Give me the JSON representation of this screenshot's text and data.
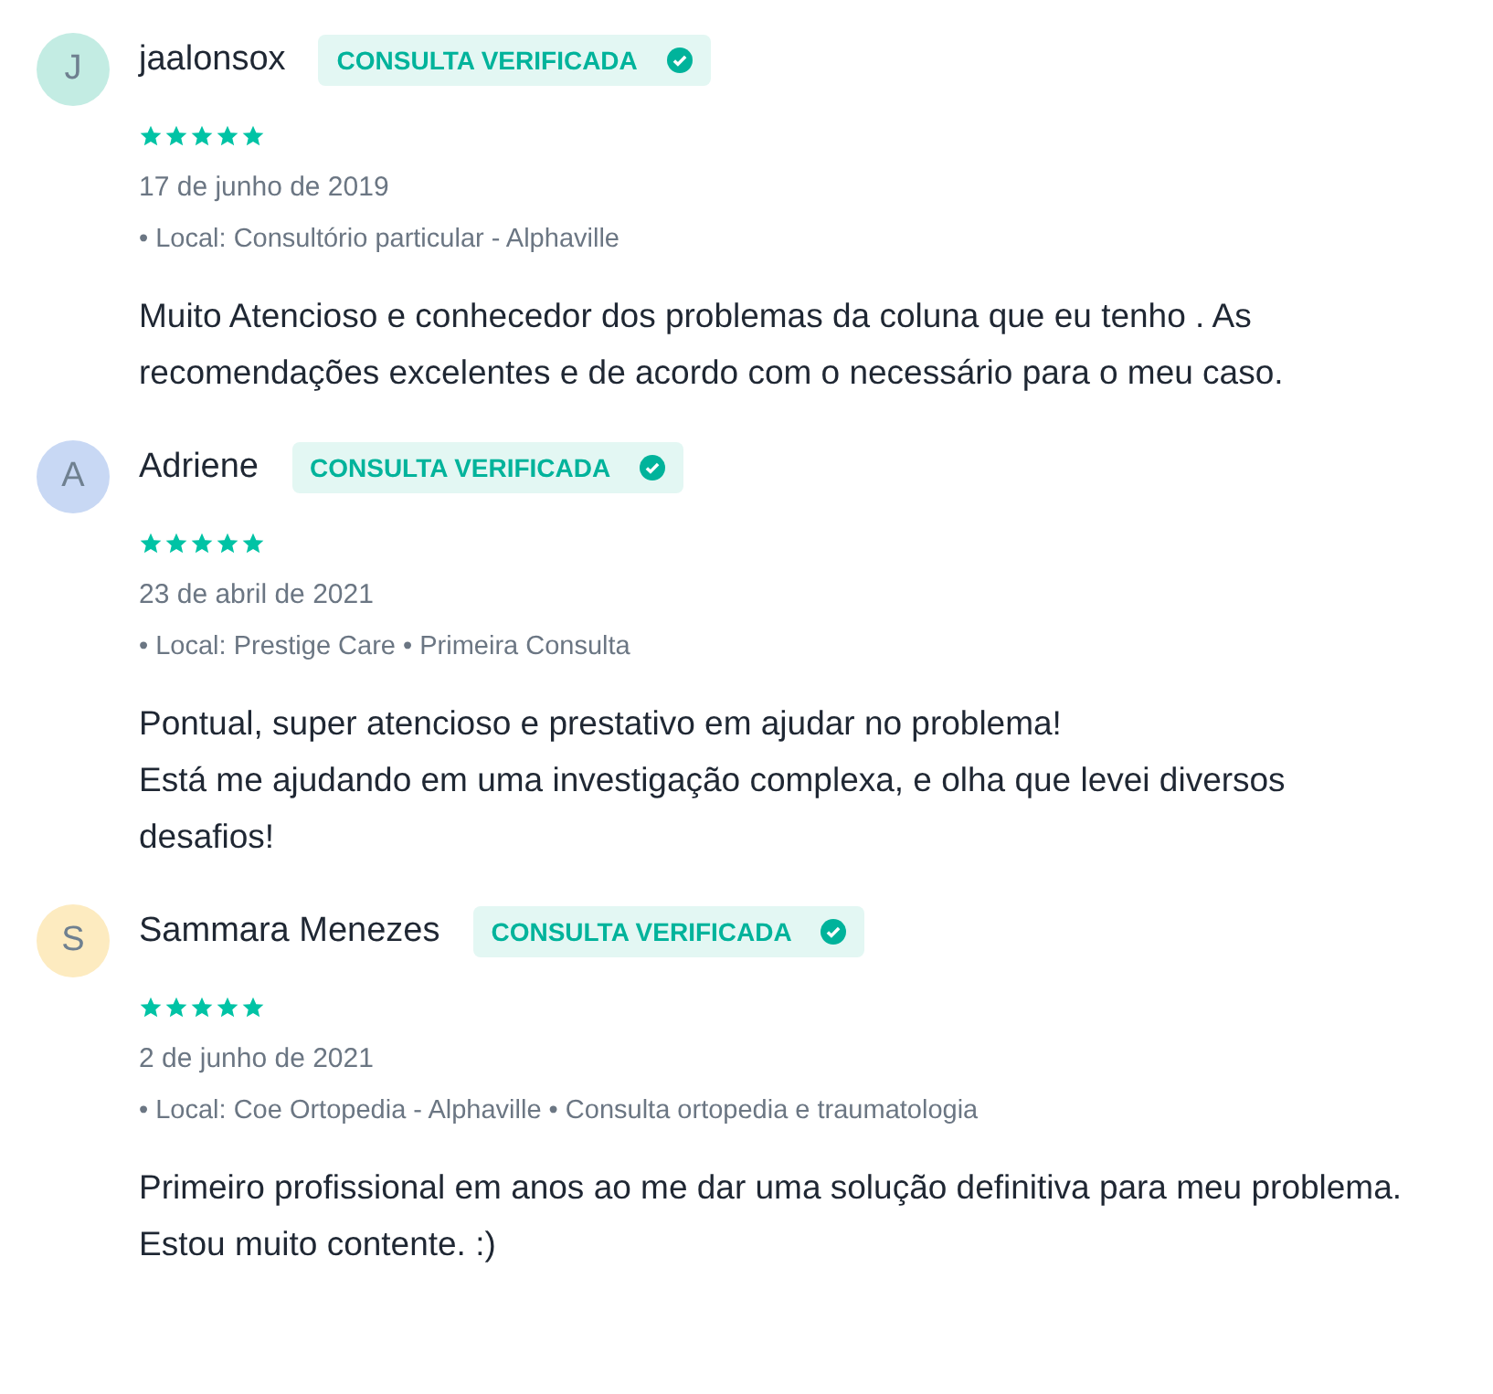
{
  "reviews": [
    {
      "initial": "J",
      "color": "#c3ece3",
      "name": "jaalonsox",
      "badge": "CONSULTA VERIFICADA",
      "stars": 5,
      "date": "17 de junho de 2019",
      "location": "• Local: Consultório particular - Alphaville",
      "comment": [
        "Muito Atencioso e conhecedor dos problemas da coluna que eu tenho . As recomendações excelentes e de acordo com o necessário para o meu caso."
      ]
    },
    {
      "initial": "A",
      "color": "#c8d8f4",
      "name": "Adriene",
      "badge": "CONSULTA VERIFICADA",
      "stars": 5,
      "date": "23 de abril de 2021",
      "location": "• Local: Prestige Care • Primeira Consulta",
      "comment": [
        "Pontual, super atencioso e prestativo em ajudar no problema!",
        "Está me ajudando em uma investigação complexa, e olha que levei diversos desafios!"
      ]
    },
    {
      "initial": "S",
      "color": "#fdebc0",
      "name": "Sammara Menezes",
      "badge": "CONSULTA VERIFICADA",
      "stars": 5,
      "date": "2 de junho de 2021",
      "location": "• Local: Coe Ortopedia - Alphaville • Consulta ortopedia e traumatologia",
      "comment": [
        "Primeiro profissional em anos ao me dar uma solução definitiva para meu problema. Estou muito contente. :)"
      ]
    }
  ]
}
